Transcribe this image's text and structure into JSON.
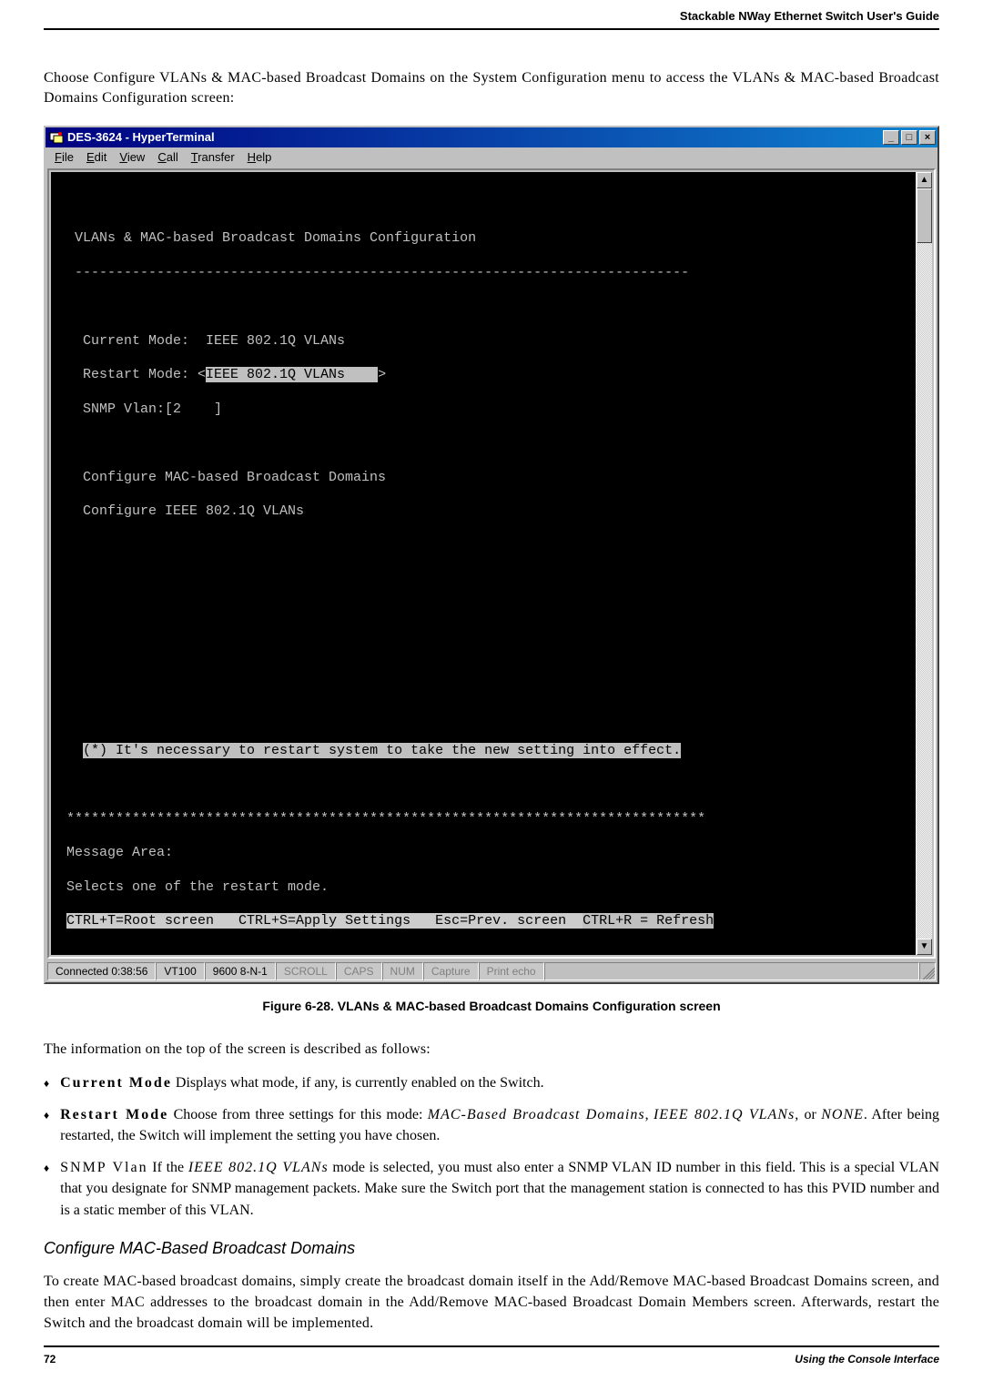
{
  "header": {
    "running_title": "Stackable NWay Ethernet Switch User's Guide"
  },
  "intro": "Choose Configure VLANs & MAC-based Broadcast Domains on the System Configuration menu to access the VLANs & MAC-based Broadcast Domains Configuration screen:",
  "window": {
    "title": "DES-3624 - HyperTerminal",
    "menu": {
      "file": "File",
      "edit": "Edit",
      "view": "View",
      "call": "Call",
      "transfer": "Transfer",
      "help": "Help"
    },
    "title_buttons": {
      "minimize": "_",
      "maximize": "□",
      "close": "×"
    },
    "scroll": {
      "up": "▲",
      "down": "▼"
    }
  },
  "terminal": {
    "heading": "  VLANs & MAC-based Broadcast Domains Configuration",
    "rule": "  ---------------------------------------------------------------------------",
    "current_mode": "   Current Mode:  IEEE 802.1Q VLANs",
    "restart_prefix": "   Restart Mode: <",
    "restart_value": "IEEE 802.1Q VLANs    ",
    "restart_suffix": ">",
    "snmp_vlan": "   SNMP Vlan:[2    ]",
    "cfg_mac": "   Configure MAC-based Broadcast Domains",
    "cfg_8021q": "   Configure IEEE 802.1Q VLANs",
    "note_inv": "(*) It's necessary to restart system to take the new setting into effect.",
    "stars": " ******************************************************************************",
    "msg_area": " Message Area:",
    "msg_text": " Selects one of the restart mode.",
    "foot_prefix": "CTRL+T=Root screen   CTRL+S=Apply Settings   Esc=Prev. screen  ",
    "foot_inv": "CTRL+R = Refresh"
  },
  "status": {
    "connected": "Connected 0:38:56",
    "term": "VT100",
    "baud": "9600 8-N-1",
    "scroll": "SCROLL",
    "caps": "CAPS",
    "num": "NUM",
    "capture": "Capture",
    "printecho": "Print echo"
  },
  "figure_caption": "Figure 6-28.  VLANs & MAC-based Broadcast Domains Configuration screen",
  "after_fig": "The information on the top of the screen is described as follows:",
  "bullets": [
    {
      "lead": "Current Mode",
      "rest": "  Displays what mode, if any,  is currently enabled on the Switch."
    },
    {
      "lead": "Restart Mode",
      "rest_before_italic": "  Choose from three settings for this mode: ",
      "italic": "MAC-Based Broadcast Domains",
      "rest_mid": ", ",
      "italic2": "IEEE 802.1Q VLANs,",
      "rest_mid2": " or ",
      "italic3": "NONE",
      "rest_after": ". After being restarted, the Switch will implement the setting you have chosen."
    },
    {
      "lead": "SNMP Vlan",
      "rest_before_italic": "  If the ",
      "italic": "IEEE 802.1Q VLANs",
      "rest_after": " mode is selected, you must also enter a SNMP VLAN ID number in this field. This is a special VLAN that you designate for SNMP management packets. Make sure the Switch port that the management station is connected to has this PVID number and is a static member of this VLAN."
    }
  ],
  "subhead": "Configure MAC-Based Broadcast Domains",
  "para2": "To create MAC-based broadcast domains, simply create the broadcast domain itself in the Add/Remove MAC-based Broadcast Domains screen, and then enter MAC addresses to the broadcast domain in the Add/Remove MAC-based Broadcast Domain Members screen. Afterwards, restart the Switch and the broadcast domain will be implemented.",
  "footer": {
    "page": "72",
    "section": "Using the Console Interface"
  }
}
